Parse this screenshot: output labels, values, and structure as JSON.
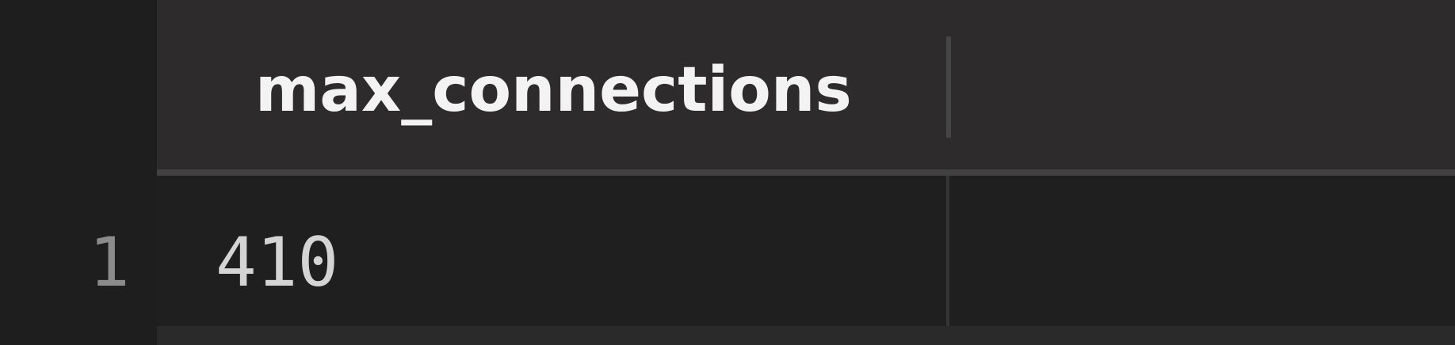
{
  "table": {
    "columns": [
      "max_connections"
    ],
    "rows": [
      {
        "row_number": "1",
        "cells": [
          "410"
        ]
      }
    ]
  },
  "colors": {
    "background": "#1f1f1f",
    "header_background": "#2d2b2c",
    "header_text": "#f3f3f3",
    "cell_text": "#d4d4d4",
    "row_number_text": "#8b8b8b",
    "border": "#414141"
  }
}
